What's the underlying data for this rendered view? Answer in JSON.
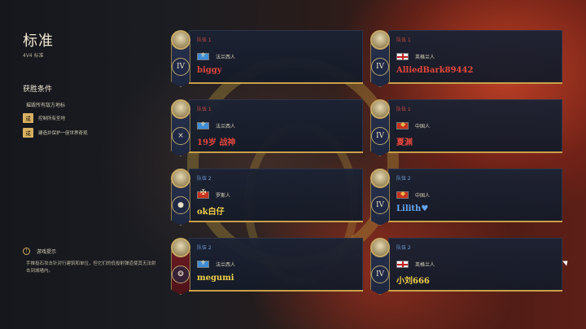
{
  "mode": {
    "title": "标准",
    "subtitle": "4V4 标准"
  },
  "victory": {
    "title": "获胜条件",
    "primary": "摧毁所有敌方地标",
    "conditions": [
      {
        "badge": "或",
        "text": "控制所有圣地"
      },
      {
        "badge": "或",
        "text": "建造并保护一座世界奇观"
      }
    ]
  },
  "tip": {
    "icon": "info-icon",
    "title": "游戏提示",
    "body": "手推投石攻击针对行建筑和单位，但它们的低投射弹道使其无法射击到城墙内。"
  },
  "players": [
    {
      "team": "队伍 1",
      "team_color": "#d04a3a",
      "civ": "法兰西人",
      "flag": "france-flag",
      "name": "biggy",
      "name_color": "#e2463b",
      "banner": "IV"
    },
    {
      "team": "队伍 1",
      "team_color": "#d04a3a",
      "civ": "英格兰人",
      "flag": "england-flag",
      "name": "AlliedBark89442",
      "name_color": "#e2463b",
      "banner": "IV"
    },
    {
      "team": "队伍 1",
      "team_color": "#d04a3a",
      "civ": "法兰西人",
      "flag": "france-flag",
      "name": "19岁 战神",
      "name_color": "#e2463b",
      "banner": "×"
    },
    {
      "team": "队伍 1",
      "team_color": "#d04a3a",
      "civ": "中国人",
      "flag": "china-flag",
      "name": "夏渊",
      "name_color": "#e2463b",
      "banner": "IV"
    },
    {
      "team": "队伍 2",
      "team_color": "#6e9ed8",
      "civ": "罗斯人",
      "flag": "rus-flag",
      "name": "ok白仔",
      "name_color": "#f2d14a",
      "banner": "●"
    },
    {
      "team": "队伍 2",
      "team_color": "#6e9ed8",
      "civ": "中国人",
      "flag": "china-flag",
      "name": "Lilith♥",
      "name_color": "#66a6ee",
      "banner": "IV"
    },
    {
      "team": "队伍 2",
      "team_color": "#6e9ed8",
      "civ": "法兰西人",
      "flag": "france-flag",
      "name": "megumi",
      "name_color": "#f2d14a",
      "banner": "❂"
    },
    {
      "team": "队伍 2",
      "team_color": "#6e9ed8",
      "civ": "英格兰人",
      "flag": "england-flag",
      "name": "小刘666",
      "name_color": "#f2d14a",
      "banner": "IV"
    }
  ]
}
